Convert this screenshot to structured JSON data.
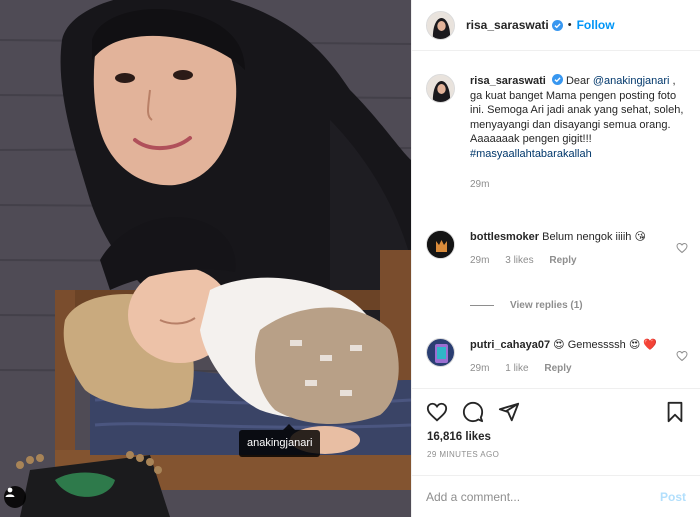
{
  "photo": {
    "tag_label": "anakingjanari"
  },
  "header": {
    "username": "risa_saraswati",
    "separator": "•",
    "follow_label": "Follow"
  },
  "caption": {
    "username": "risa_saraswati",
    "text_1": "Dear",
    "mention": "@anakingjanari",
    "text_2": ", ga kuat banget Mama pengen posting foto ini. Semoga Ari jadi anak yang sehat, soleh, menyayangi dan disayangi semua orang. Aaaaaaak pengen gigit!!!",
    "hashtag": "#masyaallahtabarakallah",
    "time": "29m"
  },
  "comments": [
    {
      "username": "bottlesmoker",
      "text": "Belum nengok iiiih 😘",
      "time": "29m",
      "likes": "3 likes",
      "reply": "Reply"
    },
    {
      "username": "putri_cahaya07",
      "text": "😍 Gemessssh 😍 ❤️",
      "time": "29m",
      "likes": "1 like",
      "reply": "Reply"
    }
  ],
  "view_replies": "View replies (1)",
  "actions": {
    "likes": "16,816 likes",
    "timestamp": "29 MINUTES AGO"
  },
  "add_comment": {
    "placeholder": "Add a comment...",
    "post_label": "Post"
  },
  "colors": {
    "follow_blue": "#0095f6",
    "verified_blue": "#3897f0",
    "mention_link": "#00376b",
    "post_disabled": "#b2dffc",
    "heart_red": "#ed4956"
  },
  "icons": [
    "user-tag-icon",
    "verified-badge-icon",
    "heart-icon",
    "comment-icon",
    "share-icon",
    "save-icon"
  ]
}
